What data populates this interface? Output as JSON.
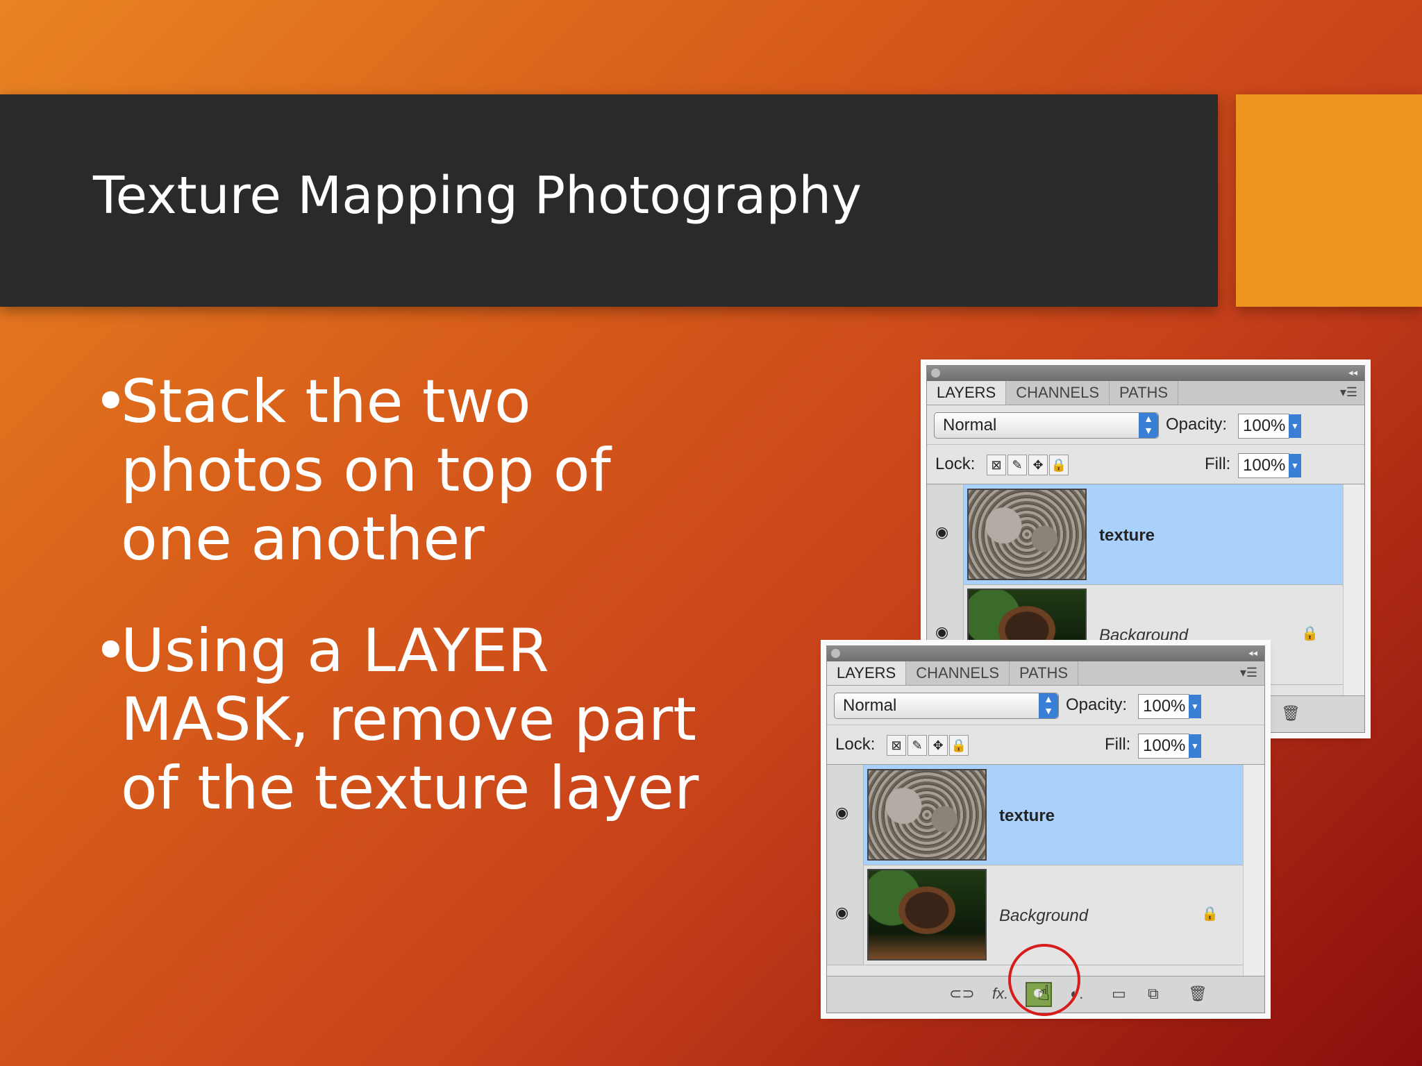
{
  "slide": {
    "title": "Texture Mapping Photography",
    "bullets": [
      {
        "symbol": "•",
        "text": "Stack the two photos on top of one another"
      },
      {
        "symbol": "•",
        "text": "Using a LAYER MASK, remove part of the texture layer"
      }
    ]
  },
  "panel": {
    "tabs": [
      "LAYERS",
      "CHANNELS",
      "PATHS"
    ],
    "blend_mode": "Normal",
    "opacity_label": "Opacity:",
    "opacity_value": "100%",
    "lock_label": "Lock:",
    "fill_label": "Fill:",
    "fill_value": "100%",
    "layers": [
      {
        "name": "texture",
        "selected": true,
        "icon": "eye-icon"
      },
      {
        "name": "Background",
        "selected": false,
        "icon": "eye-icon",
        "locked": true
      }
    ],
    "footer_icons": [
      "link-icon",
      "fx-icon",
      "add-mask-icon",
      "adjustment-icon",
      "folder-icon",
      "new-layer-icon",
      "trash-icon"
    ],
    "fx_label": "fx."
  },
  "colors": {
    "accent": "#ee9520",
    "title_bar": "#2a2a2a",
    "highlight": "#d81c1c",
    "selected_layer": "#a9d1fb"
  }
}
